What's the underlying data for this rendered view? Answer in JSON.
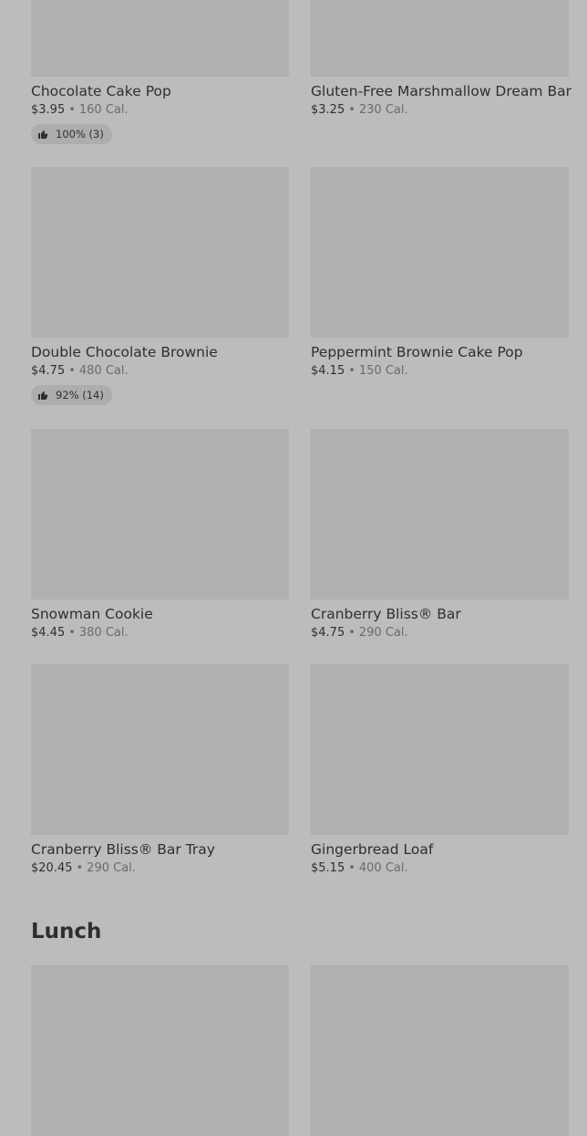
{
  "rows": [
    [
      {
        "name": "Chocolate Cake Pop",
        "price": "$3.95",
        "sep": "•",
        "calories": "160 Cal.",
        "rating": "100% (3)"
      },
      {
        "name": "Gluten-Free Marshmallow Dream Bar",
        "price": "$3.25",
        "sep": "•",
        "calories": "230 Cal.",
        "rating": null
      }
    ],
    [
      {
        "name": "Double Chocolate Brownie",
        "price": "$4.75",
        "sep": "•",
        "calories": "480 Cal.",
        "rating": "92% (14)"
      },
      {
        "name": "Peppermint Brownie Cake Pop",
        "price": "$4.15",
        "sep": "•",
        "calories": "150 Cal.",
        "rating": null
      }
    ],
    [
      {
        "name": "Snowman Cookie",
        "price": "$4.45",
        "sep": "•",
        "calories": "380 Cal.",
        "rating": null
      },
      {
        "name": "Cranberry Bliss® Bar",
        "price": "$4.75",
        "sep": "•",
        "calories": "290 Cal.",
        "rating": null
      }
    ],
    [
      {
        "name": "Cranberry Bliss® Bar Tray",
        "price": "$20.45",
        "sep": "•",
        "calories": "290 Cal.",
        "rating": null
      },
      {
        "name": "Gingerbread Loaf",
        "price": "$5.15",
        "sep": "•",
        "calories": "400 Cal.",
        "rating": null
      }
    ]
  ],
  "section": {
    "title": "Lunch"
  },
  "icons": {
    "rating": "thumbs-up-icon"
  },
  "colors": {
    "background": "#bcbcbc",
    "image_placeholder": "#b0b0b0",
    "badge": "#adadad",
    "text": "#2f2f2f",
    "muted_text": "#6a6a6a"
  }
}
